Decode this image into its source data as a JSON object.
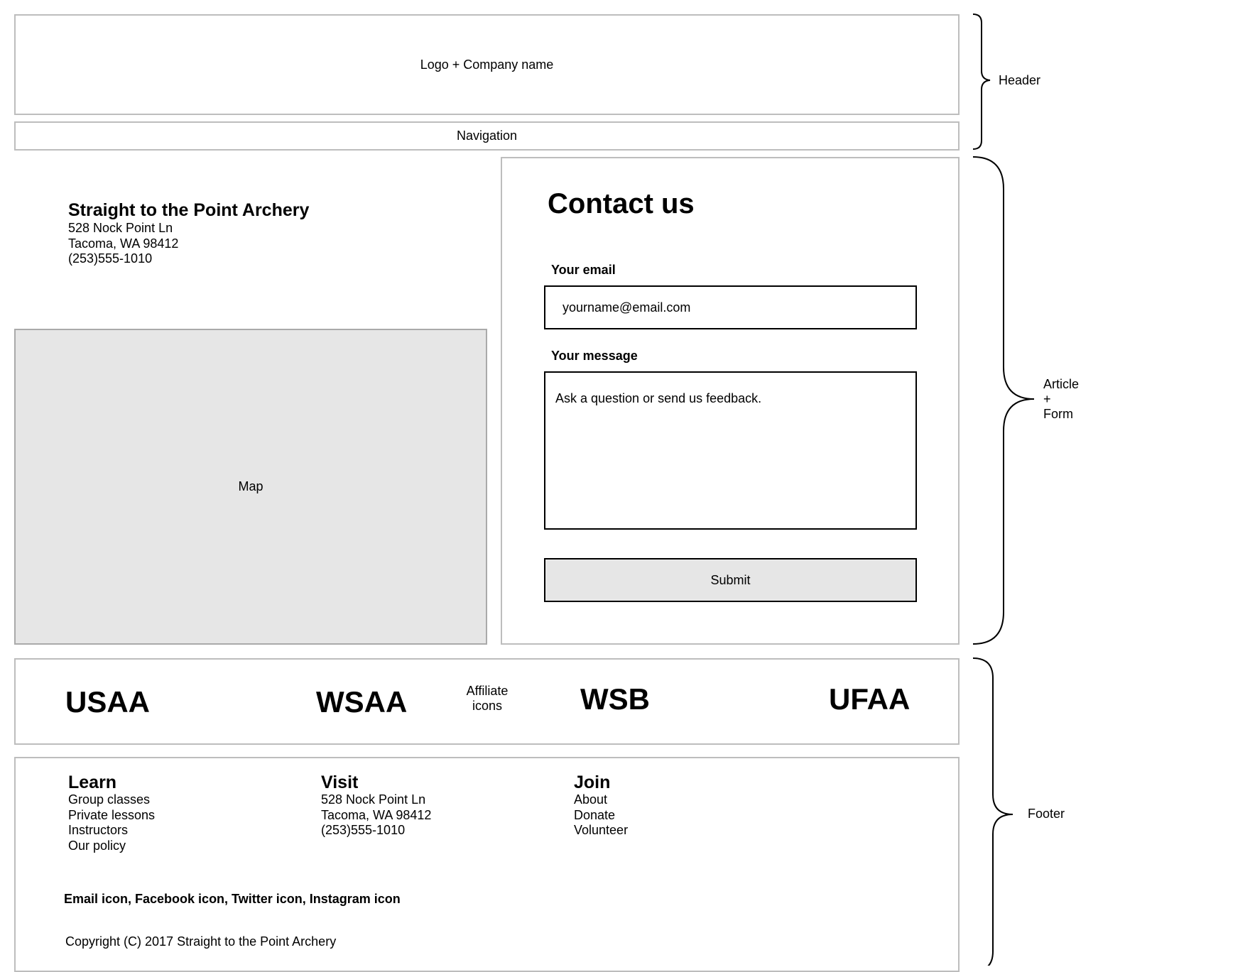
{
  "header": {
    "logo_placeholder": "Logo + Company name",
    "navigation_placeholder": "Navigation"
  },
  "article": {
    "company_name": "Straight to the Point Archery",
    "address_line1": "528 Nock Point Ln",
    "address_line2": "Tacoma, WA 98412",
    "phone": "(253)555-1010",
    "map_placeholder": "Map"
  },
  "form": {
    "title": "Contact us",
    "email_label": "Your email",
    "email_value": "yourname@email.com",
    "message_label": "Your message",
    "message_value": "Ask a question or send us feedback.",
    "submit_label": "Submit"
  },
  "affiliates": {
    "items": [
      "USAA",
      "WSAA",
      "WSB",
      "UFAA"
    ],
    "caption_line1": "Affiliate",
    "caption_line2": "icons"
  },
  "footer": {
    "columns": [
      {
        "heading": "Learn",
        "items": [
          "Group classes",
          "Private lessons",
          "Instructors",
          "Our policy"
        ]
      },
      {
        "heading": "Visit",
        "items": [
          "528 Nock Point Ln",
          "Tacoma, WA 98412",
          "(253)555-1010"
        ]
      },
      {
        "heading": "Join",
        "items": [
          "About",
          "Donate",
          "Volunteer"
        ]
      }
    ],
    "social_icons_text": "Email icon, Facebook icon, Twitter icon, Instagram icon",
    "copyright": "Copyright (C) 2017 Straight to the Point Archery"
  },
  "annotations": {
    "header": "Header",
    "article_line1": "Article",
    "article_line2": "+",
    "article_line3": "Form",
    "footer": "Footer"
  }
}
